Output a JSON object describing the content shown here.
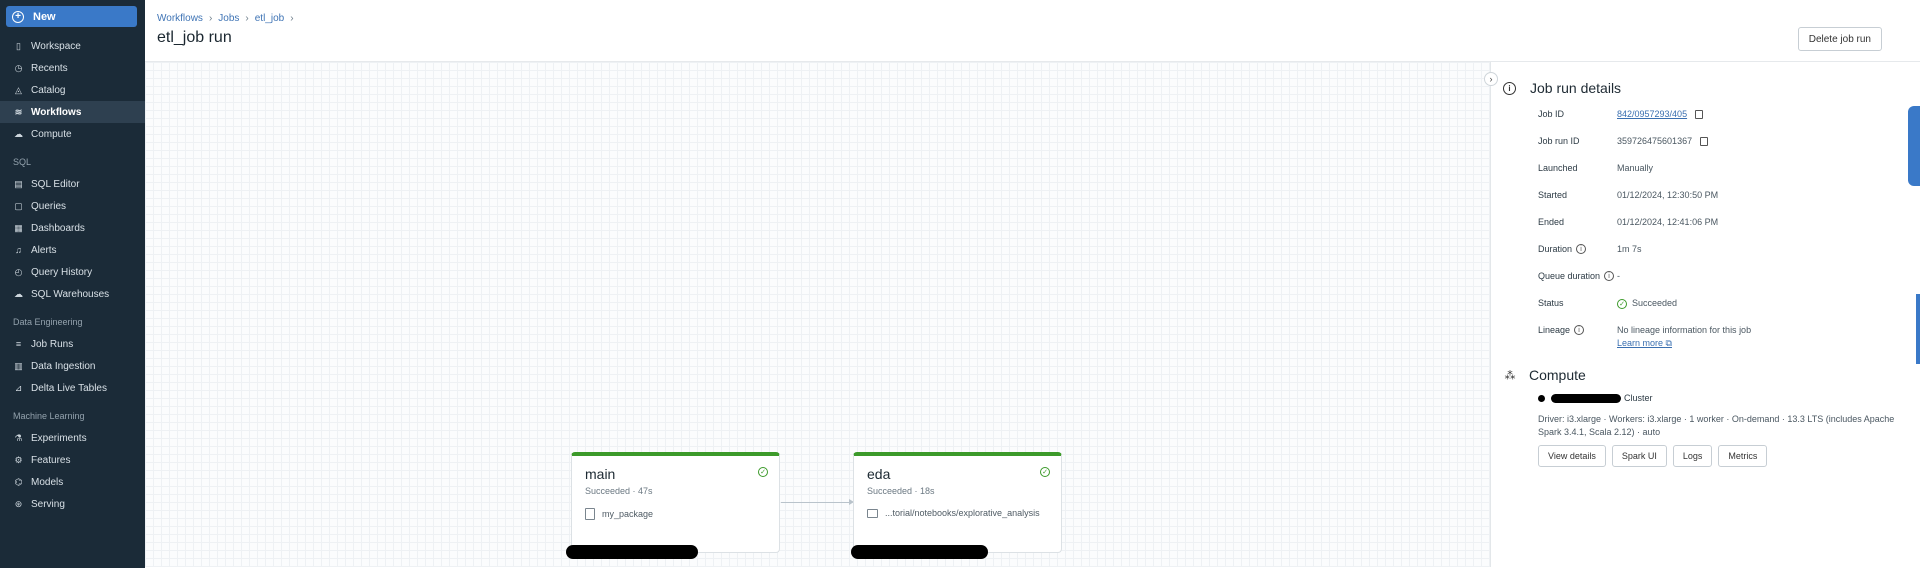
{
  "sidebar": {
    "new_label": "New",
    "items_top": [
      {
        "label": "Workspace",
        "icon": "workspace-icon",
        "glyph": "▯"
      },
      {
        "label": "Recents",
        "icon": "clock-icon",
        "glyph": "◷"
      },
      {
        "label": "Catalog",
        "icon": "catalog-icon",
        "glyph": "◬"
      },
      {
        "label": "Workflows",
        "icon": "workflows-icon",
        "glyph": "≋"
      },
      {
        "label": "Compute",
        "icon": "cloud-icon",
        "glyph": "☁"
      }
    ],
    "sql_section": "SQL",
    "items_sql": [
      {
        "label": "SQL Editor",
        "icon": "editor-icon",
        "glyph": "▤"
      },
      {
        "label": "Queries",
        "icon": "queries-icon",
        "glyph": "▢"
      },
      {
        "label": "Dashboards",
        "icon": "dashboards-icon",
        "glyph": "▦"
      },
      {
        "label": "Alerts",
        "icon": "bell-icon",
        "glyph": "♫"
      },
      {
        "label": "Query History",
        "icon": "history-icon",
        "glyph": "◴"
      },
      {
        "label": "SQL Warehouses",
        "icon": "warehouse-icon",
        "glyph": "☁"
      }
    ],
    "de_section": "Data Engineering",
    "items_de": [
      {
        "label": "Job Runs",
        "icon": "job-runs-icon",
        "glyph": "≡"
      },
      {
        "label": "Data Ingestion",
        "icon": "ingestion-icon",
        "glyph": "▥"
      },
      {
        "label": "Delta Live Tables",
        "icon": "delta-icon",
        "glyph": "⊿"
      }
    ],
    "ml_section": "Machine Learning",
    "items_ml": [
      {
        "label": "Experiments",
        "icon": "experiments-icon",
        "glyph": "⚗"
      },
      {
        "label": "Features",
        "icon": "features-icon",
        "glyph": "⚙"
      },
      {
        "label": "Models",
        "icon": "models-icon",
        "glyph": "⌬"
      },
      {
        "label": "Serving",
        "icon": "serving-icon",
        "glyph": "⊛"
      }
    ]
  },
  "header": {
    "breadcrumb": [
      "Workflows",
      "Jobs",
      "etl_job"
    ],
    "title": "etl_job run",
    "delete_label": "Delete job run"
  },
  "tasks": [
    {
      "name": "main",
      "status": "Succeeded · 47s",
      "path": "my_package"
    },
    {
      "name": "eda",
      "status": "Succeeded · 18s",
      "path": "...torial/notebooks/explorative_analysis"
    }
  ],
  "details": {
    "title": "Job run details",
    "rows": {
      "job_id_label": "Job ID",
      "job_id": "842/0957293/405",
      "job_run_id_label": "Job run ID",
      "job_run_id": "359726475601367",
      "launched_label": "Launched",
      "launched": "Manually",
      "started_label": "Started",
      "started": "01/12/2024, 12:30:50 PM",
      "ended_label": "Ended",
      "ended": "01/12/2024, 12:41:06 PM",
      "duration_label": "Duration",
      "duration": "1m 7s",
      "queue_label": "Queue duration",
      "queue": "-",
      "status_label": "Status",
      "status": "Succeeded",
      "lineage_label": "Lineage",
      "lineage": "No lineage information for this job",
      "learn_more": "Learn more"
    }
  },
  "compute": {
    "title": "Compute",
    "cluster_suffix": "Cluster",
    "description": "Driver: i3.xlarge · Workers: i3.xlarge · 1 worker · On-demand · 13.3 LTS (includes Apache Spark 3.4.1, Scala 2.12) · auto",
    "buttons": [
      "View details",
      "Spark UI",
      "Logs",
      "Metrics"
    ]
  },
  "colors": {
    "sidebar_bg": "#1b2b38",
    "accent": "#3a79c8",
    "success": "#3c9a2a"
  }
}
